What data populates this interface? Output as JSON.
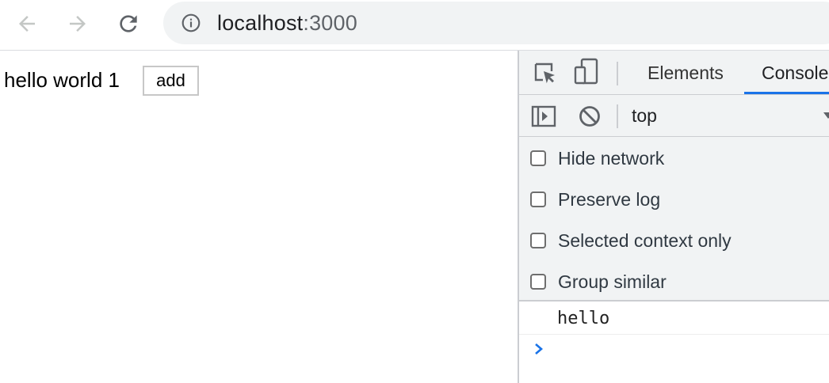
{
  "browser": {
    "url_host": "localhost",
    "url_port": ":3000"
  },
  "page": {
    "text": "hello world 1",
    "add_button_label": "add"
  },
  "devtools": {
    "tabs": [
      {
        "label": "Elements",
        "active": false
      },
      {
        "label": "Console",
        "active": true
      }
    ],
    "context": "top",
    "settings": [
      {
        "label": "Hide network",
        "checked": false
      },
      {
        "label": "Preserve log",
        "checked": false
      },
      {
        "label": "Selected context only",
        "checked": false
      },
      {
        "label": "Group similar",
        "checked": false
      }
    ],
    "messages": [
      "hello"
    ],
    "accent_color": "#1a73e8"
  }
}
